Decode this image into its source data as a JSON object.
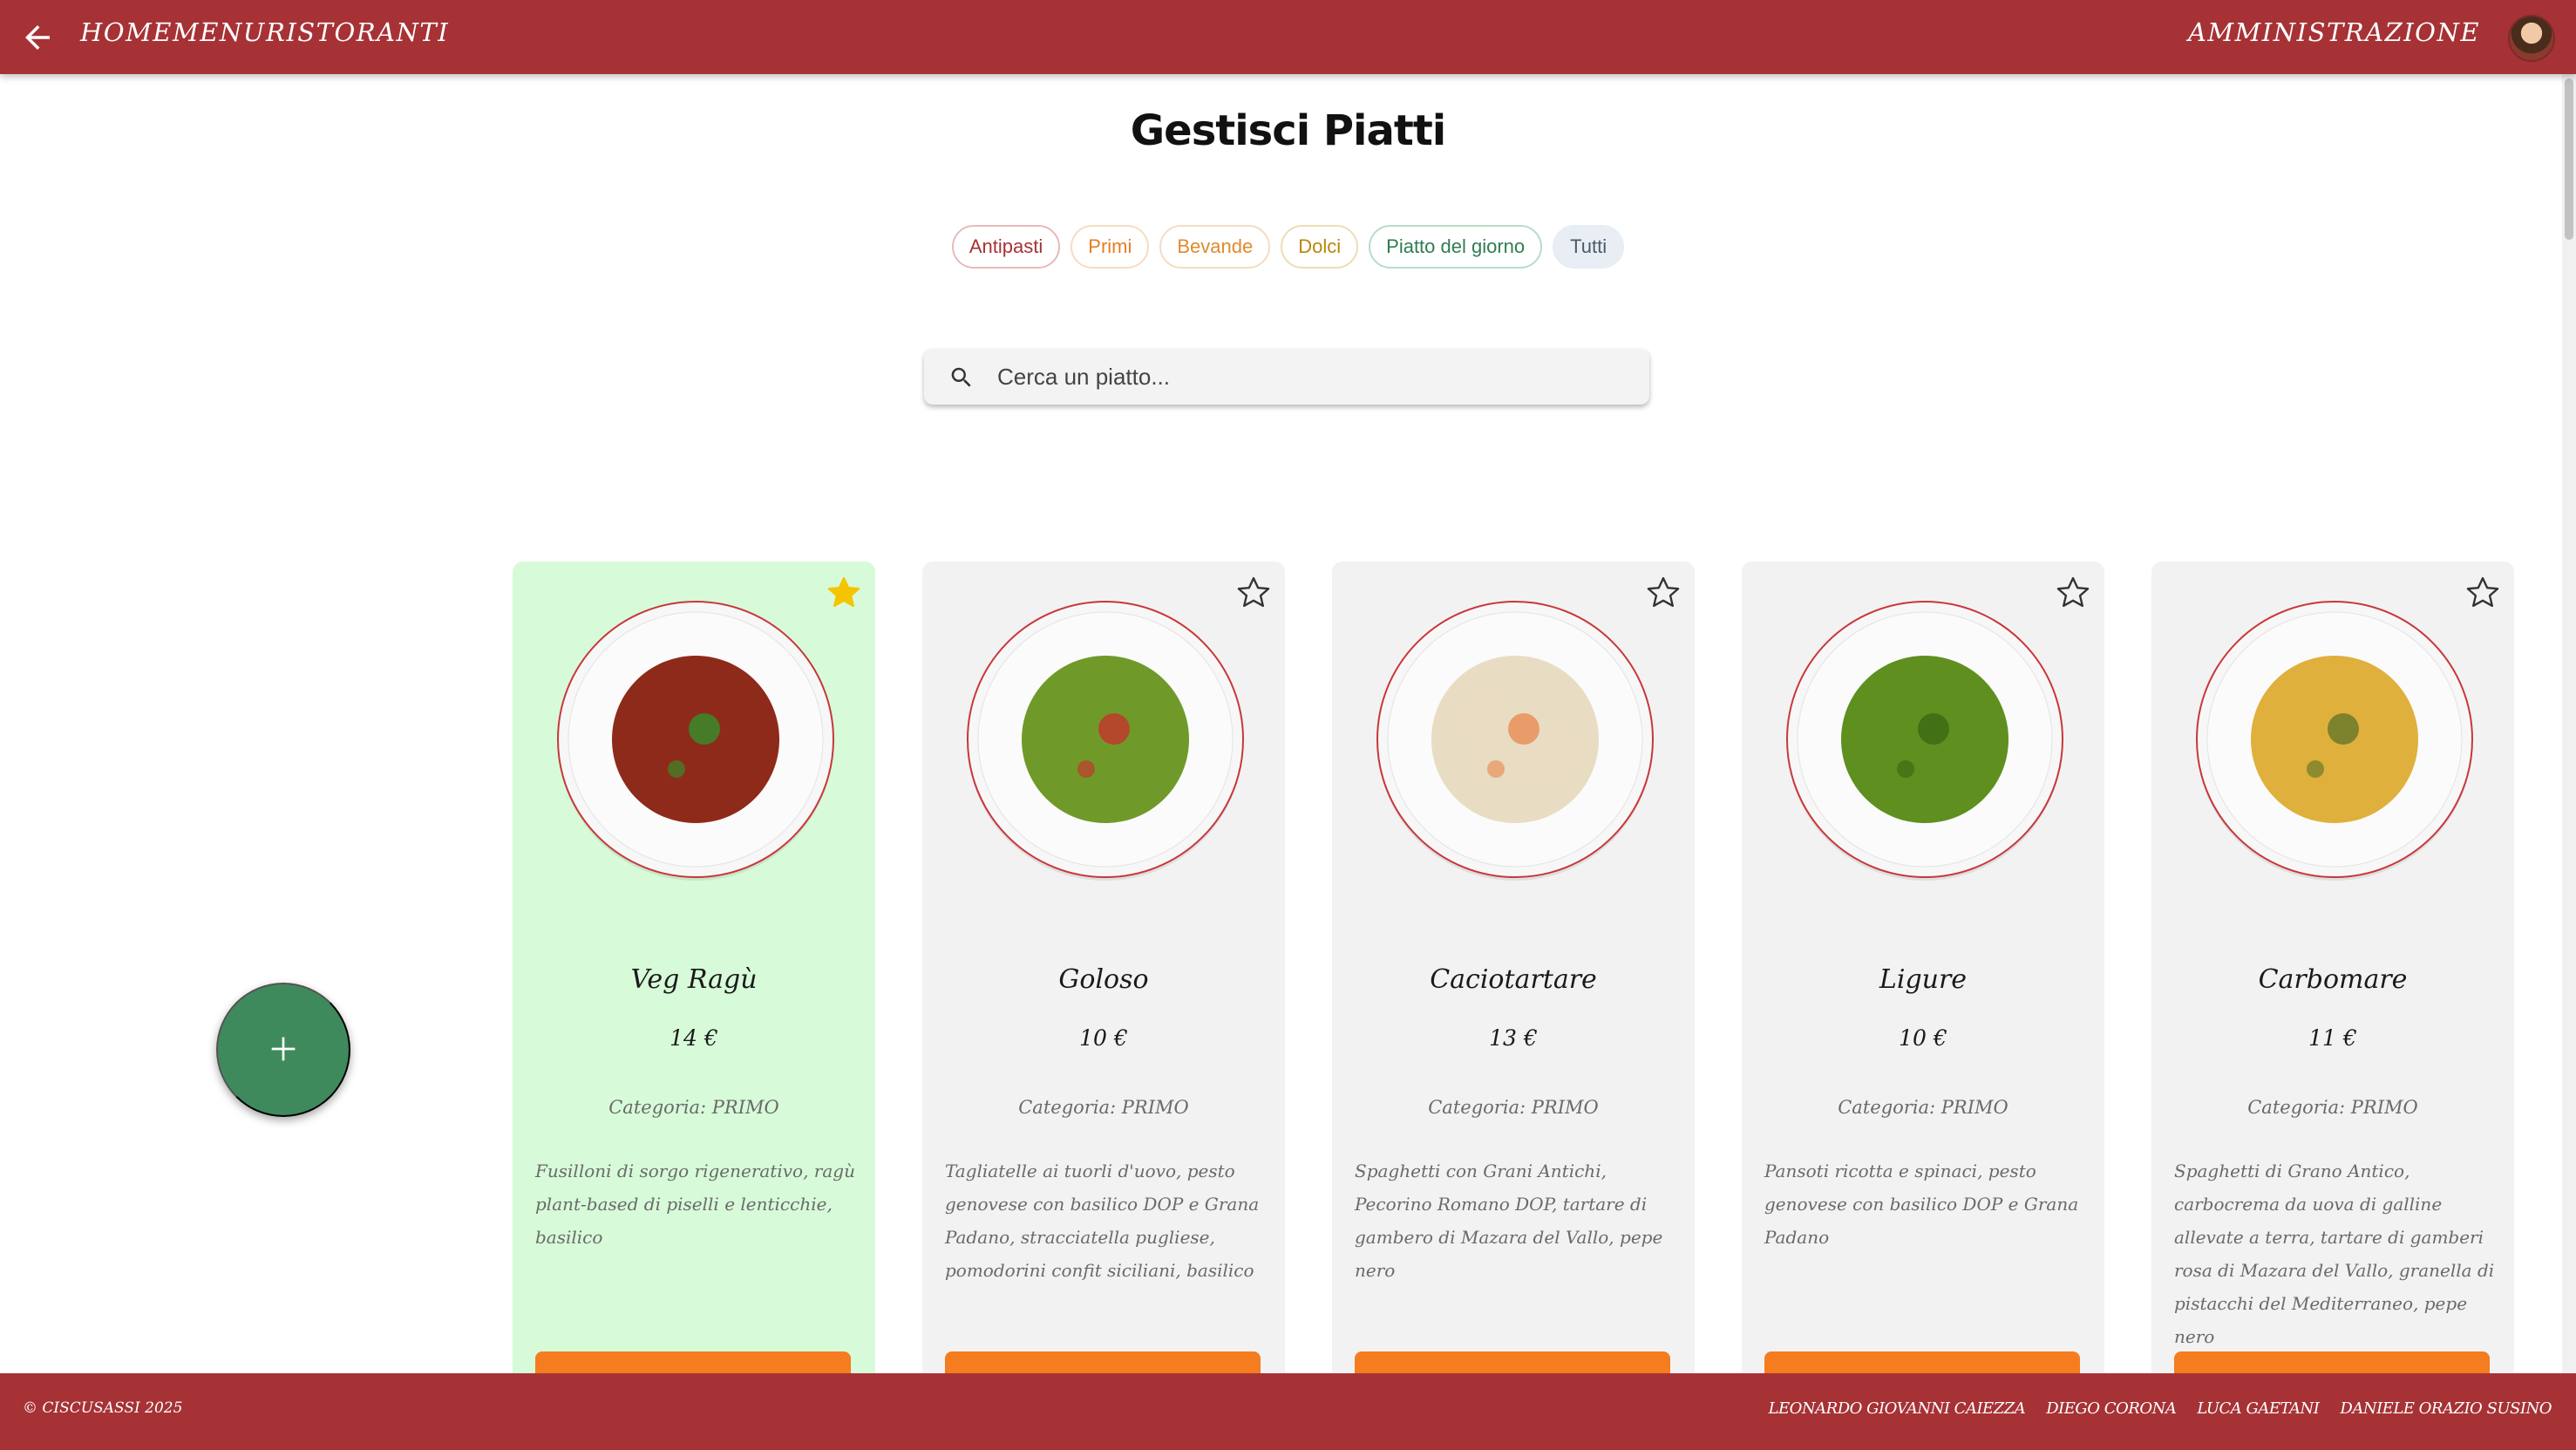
{
  "header": {
    "nav": [
      {
        "label": "HOME"
      },
      {
        "label": "MENU"
      },
      {
        "label": "RISTORANTI"
      }
    ],
    "admin_label": "AMMINISTRAZIONE"
  },
  "page": {
    "title": "Gestisci Piatti"
  },
  "filters": [
    {
      "label": "Antipasti"
    },
    {
      "label": "Primi"
    },
    {
      "label": "Bevande"
    },
    {
      "label": "Dolci"
    },
    {
      "label": "Piatto del giorno"
    },
    {
      "label": "Tutti"
    }
  ],
  "search": {
    "placeholder": "Cerca un piatto...",
    "value": ""
  },
  "dishes": [
    {
      "name": "Veg Ragù",
      "price": "14 €",
      "category": "Categoria: PRIMO",
      "description": "Fusilloni di sorgo rigenerativo, ragù plant-based di piselli e lenticchie, basilico",
      "favorite": true,
      "pasta_color": "#8e2a1a",
      "topping_color": "#3a8a2a"
    },
    {
      "name": "Goloso",
      "price": "10 €",
      "category": "Categoria: PRIMO",
      "description": "Tagliatelle ai tuorli d'uovo, pesto genovese con basilico DOP e Grana Padano, stracciatella pugliese, pomodorini confit siciliani, basilico",
      "favorite": false,
      "pasta_color": "#6f9a2a",
      "topping_color": "#c0392b"
    },
    {
      "name": "Caciotartare",
      "price": "13 €",
      "category": "Categoria: PRIMO",
      "description": "Spaghetti con Grani Antichi, Pecorino Romano DOP, tartare di gambero di Mazara del Vallo, pepe nero",
      "favorite": false,
      "pasta_color": "#e8dcc2",
      "topping_color": "#e8915a"
    },
    {
      "name": "Ligure",
      "price": "10 €",
      "category": "Categoria: PRIMO",
      "description": "Pansoti ricotta e spinaci, pesto genovese con basilico DOP e Grana Padano",
      "favorite": false,
      "pasta_color": "#5e8f1f",
      "topping_color": "#3d6b14"
    },
    {
      "name": "Carbomare",
      "price": "11 €",
      "category": "Categoria: PRIMO",
      "description": "Spaghetti di Grano Antico, carbocrema da uova di galline allevate a terra, tartare di gamberi rosa di Mazara del Vallo, granella di pistacchi del Mediterraneo, pepe nero",
      "favorite": false,
      "pasta_color": "#e0b03c",
      "topping_color": "#6b7a2a"
    }
  ],
  "footer": {
    "copyright": "© CISCUSASSI 2025",
    "authors": [
      "LEONARDO GIOVANNI CAIEZZA",
      "DIEGO CORONA",
      "LUCA GAETANI",
      "DANIELE ORAZIO SUSINO"
    ]
  },
  "colors": {
    "brand": "#a63236",
    "favorite_card": "#d7fbd9",
    "card": "#f2f2f2",
    "fab": "#3f8a5c",
    "order_button": "#f57c1f",
    "star_active": "#f5c400"
  },
  "icons": {
    "back": "arrow-left-icon",
    "search": "magnifier-icon",
    "add": "plus-icon",
    "favorite": "star-icon"
  }
}
